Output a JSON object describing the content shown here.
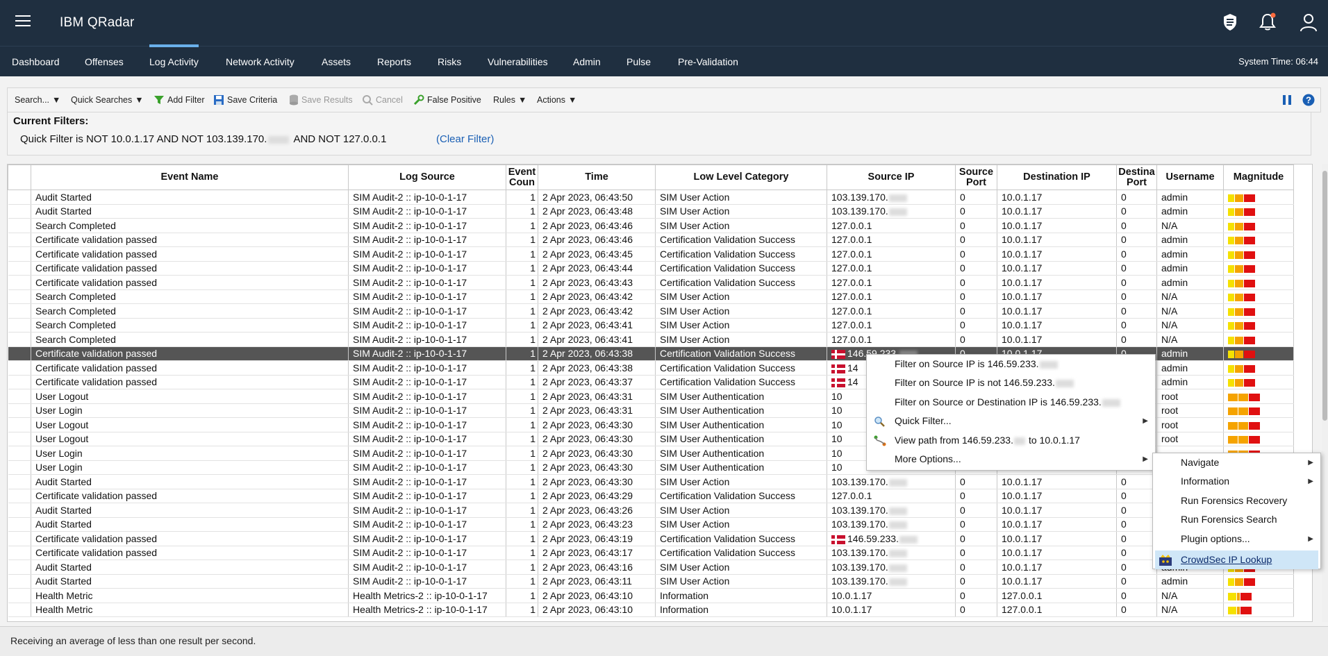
{
  "app": {
    "title": "IBM QRadar",
    "system_time": "System Time: 06:44"
  },
  "nav": {
    "tabs": [
      {
        "label": "Dashboard"
      },
      {
        "label": "Offenses"
      },
      {
        "label": "Log Activity",
        "active": true
      },
      {
        "label": "Network Activity"
      },
      {
        "label": "Assets"
      },
      {
        "label": "Reports"
      },
      {
        "label": "Risks"
      },
      {
        "label": "Vulnerabilities"
      },
      {
        "label": "Admin"
      },
      {
        "label": "Pulse"
      },
      {
        "label": "Pre-Validation"
      }
    ]
  },
  "toolbar": {
    "search": "Search...",
    "quick_searches": "Quick Searches",
    "add_filter": "Add Filter",
    "save_criteria": "Save Criteria",
    "save_results": "Save Results",
    "cancel": "Cancel",
    "false_positive": "False Positive",
    "rules": "Rules",
    "actions": "Actions"
  },
  "filters": {
    "title": "Current Filters:",
    "text_a": "Quick Filter is NOT 10.0.1.17 AND NOT 103.139.170.",
    "text_b": "AND NOT 127.0.0.1",
    "clear": "(Clear Filter)"
  },
  "table": {
    "columns": [
      "",
      "Event Name",
      "Log Source",
      "Event Count",
      "Time",
      "Low Level Category",
      "Source IP",
      "Source Port",
      "Destination IP",
      "Destination Port",
      "Username",
      "Magnitude"
    ],
    "header_display": [
      "",
      "Event Name",
      "Log Source",
      "Event\nCoun",
      "Time",
      "Low Level Category",
      "Source IP",
      "Source\nPort",
      "Destination IP",
      "Destina\nPort",
      "Username",
      "Magnitude"
    ],
    "rows": [
      {
        "name": "Audit Started",
        "source": "SIM Audit-2 :: ip-10-0-1-17",
        "count": "1",
        "time": "2 Apr 2023, 06:43:50",
        "cat": "SIM User Action",
        "sip": "103.139.170.",
        "sport": "0",
        "dip": "10.0.1.17",
        "dport": "0",
        "user": "admin",
        "mag": "low"
      },
      {
        "name": "Audit Started",
        "source": "SIM Audit-2 :: ip-10-0-1-17",
        "count": "1",
        "time": "2 Apr 2023, 06:43:48",
        "cat": "SIM User Action",
        "sip": "103.139.170.",
        "sport": "0",
        "dip": "10.0.1.17",
        "dport": "0",
        "user": "admin",
        "mag": "low"
      },
      {
        "name": "Search Completed",
        "source": "SIM Audit-2 :: ip-10-0-1-17",
        "count": "1",
        "time": "2 Apr 2023, 06:43:46",
        "cat": "SIM User Action",
        "sip": "127.0.0.1",
        "sport": "0",
        "dip": "10.0.1.17",
        "dport": "0",
        "user": "N/A",
        "mag": "low"
      },
      {
        "name": "Certificate validation passed",
        "source": "SIM Audit-2 :: ip-10-0-1-17",
        "count": "1",
        "time": "2 Apr 2023, 06:43:46",
        "cat": "Certification Validation Success",
        "sip": "127.0.0.1",
        "sport": "0",
        "dip": "10.0.1.17",
        "dport": "0",
        "user": "admin",
        "mag": "low"
      },
      {
        "name": "Certificate validation passed",
        "source": "SIM Audit-2 :: ip-10-0-1-17",
        "count": "1",
        "time": "2 Apr 2023, 06:43:45",
        "cat": "Certification Validation Success",
        "sip": "127.0.0.1",
        "sport": "0",
        "dip": "10.0.1.17",
        "dport": "0",
        "user": "admin",
        "mag": "low"
      },
      {
        "name": "Certificate validation passed",
        "source": "SIM Audit-2 :: ip-10-0-1-17",
        "count": "1",
        "time": "2 Apr 2023, 06:43:44",
        "cat": "Certification Validation Success",
        "sip": "127.0.0.1",
        "sport": "0",
        "dip": "10.0.1.17",
        "dport": "0",
        "user": "admin",
        "mag": "low"
      },
      {
        "name": "Certificate validation passed",
        "source": "SIM Audit-2 :: ip-10-0-1-17",
        "count": "1",
        "time": "2 Apr 2023, 06:43:43",
        "cat": "Certification Validation Success",
        "sip": "127.0.0.1",
        "sport": "0",
        "dip": "10.0.1.17",
        "dport": "0",
        "user": "admin",
        "mag": "low"
      },
      {
        "name": "Search Completed",
        "source": "SIM Audit-2 :: ip-10-0-1-17",
        "count": "1",
        "time": "2 Apr 2023, 06:43:42",
        "cat": "SIM User Action",
        "sip": "127.0.0.1",
        "sport": "0",
        "dip": "10.0.1.17",
        "dport": "0",
        "user": "N/A",
        "mag": "low"
      },
      {
        "name": "Search Completed",
        "source": "SIM Audit-2 :: ip-10-0-1-17",
        "count": "1",
        "time": "2 Apr 2023, 06:43:42",
        "cat": "SIM User Action",
        "sip": "127.0.0.1",
        "sport": "0",
        "dip": "10.0.1.17",
        "dport": "0",
        "user": "N/A",
        "mag": "low"
      },
      {
        "name": "Search Completed",
        "source": "SIM Audit-2 :: ip-10-0-1-17",
        "count": "1",
        "time": "2 Apr 2023, 06:43:41",
        "cat": "SIM User Action",
        "sip": "127.0.0.1",
        "sport": "0",
        "dip": "10.0.1.17",
        "dport": "0",
        "user": "N/A",
        "mag": "low"
      },
      {
        "name": "Search Completed",
        "source": "SIM Audit-2 :: ip-10-0-1-17",
        "count": "1",
        "time": "2 Apr 2023, 06:43:41",
        "cat": "SIM User Action",
        "sip": "127.0.0.1",
        "sport": "0",
        "dip": "10.0.1.17",
        "dport": "0",
        "user": "N/A",
        "mag": "low"
      },
      {
        "name": "Certificate validation passed",
        "source": "SIM Audit-2 :: ip-10-0-1-17",
        "count": "1",
        "time": "2 Apr 2023, 06:43:38",
        "cat": "Certification Validation Success",
        "sip": "146.59.233.",
        "flag": true,
        "sport": "0",
        "dip": "10.0.1.17",
        "dport": "0",
        "user": "admin",
        "mag": "low",
        "selected": true
      },
      {
        "name": "Certificate validation passed",
        "source": "SIM Audit-2 :: ip-10-0-1-17",
        "count": "1",
        "time": "2 Apr 2023, 06:43:38",
        "cat": "Certification Validation Success",
        "sip": "14",
        "flag": true,
        "sport": "",
        "dip": "",
        "dport": "",
        "user": "admin",
        "mag": "low"
      },
      {
        "name": "Certificate validation passed",
        "source": "SIM Audit-2 :: ip-10-0-1-17",
        "count": "1",
        "time": "2 Apr 2023, 06:43:37",
        "cat": "Certification Validation Success",
        "sip": "14",
        "flag": true,
        "sport": "",
        "dip": "",
        "dport": "",
        "user": "admin",
        "mag": "low"
      },
      {
        "name": "User Logout",
        "source": "SIM Audit-2 :: ip-10-0-1-17",
        "count": "1",
        "time": "2 Apr 2023, 06:43:31",
        "cat": "SIM User Authentication",
        "sip": "10",
        "sport": "",
        "dip": "",
        "dport": "",
        "user": "root",
        "mag": "mid"
      },
      {
        "name": "User Login",
        "source": "SIM Audit-2 :: ip-10-0-1-17",
        "count": "1",
        "time": "2 Apr 2023, 06:43:31",
        "cat": "SIM User Authentication",
        "sip": "10",
        "sport": "",
        "dip": "",
        "dport": "",
        "user": "root",
        "mag": "mid"
      },
      {
        "name": "User Logout",
        "source": "SIM Audit-2 :: ip-10-0-1-17",
        "count": "1",
        "time": "2 Apr 2023, 06:43:30",
        "cat": "SIM User Authentication",
        "sip": "10",
        "sport": "",
        "dip": "",
        "dport": "",
        "user": "root",
        "mag": "mid"
      },
      {
        "name": "User Logout",
        "source": "SIM Audit-2 :: ip-10-0-1-17",
        "count": "1",
        "time": "2 Apr 2023, 06:43:30",
        "cat": "SIM User Authentication",
        "sip": "10",
        "sport": "",
        "dip": "",
        "dport": "",
        "user": "root",
        "mag": "mid"
      },
      {
        "name": "User Login",
        "source": "SIM Audit-2 :: ip-10-0-1-17",
        "count": "1",
        "time": "2 Apr 2023, 06:43:30",
        "cat": "SIM User Authentication",
        "sip": "10",
        "sport": "",
        "dip": "",
        "dport": "",
        "user": "",
        "mag": "mid"
      },
      {
        "name": "User Login",
        "source": "SIM Audit-2 :: ip-10-0-1-17",
        "count": "1",
        "time": "2 Apr 2023, 06:43:30",
        "cat": "SIM User Authentication",
        "sip": "10",
        "sport": "",
        "dip": "",
        "dport": "",
        "user": "",
        "mag": "mid"
      },
      {
        "name": "Audit Started",
        "source": "SIM Audit-2 :: ip-10-0-1-17",
        "count": "1",
        "time": "2 Apr 2023, 06:43:30",
        "cat": "SIM User Action",
        "sip": "103.139.170.",
        "sport": "0",
        "dip": "10.0.1.17",
        "dport": "0",
        "user": "",
        "mag": "low"
      },
      {
        "name": "Certificate validation passed",
        "source": "SIM Audit-2 :: ip-10-0-1-17",
        "count": "1",
        "time": "2 Apr 2023, 06:43:29",
        "cat": "Certification Validation Success",
        "sip": "127.0.0.1",
        "sport": "0",
        "dip": "10.0.1.17",
        "dport": "0",
        "user": "",
        "mag": "low"
      },
      {
        "name": "Audit Started",
        "source": "SIM Audit-2 :: ip-10-0-1-17",
        "count": "1",
        "time": "2 Apr 2023, 06:43:26",
        "cat": "SIM User Action",
        "sip": "103.139.170.",
        "sport": "0",
        "dip": "10.0.1.17",
        "dport": "0",
        "user": "",
        "mag": "low"
      },
      {
        "name": "Audit Started",
        "source": "SIM Audit-2 :: ip-10-0-1-17",
        "count": "1",
        "time": "2 Apr 2023, 06:43:23",
        "cat": "SIM User Action",
        "sip": "103.139.170.",
        "sport": "0",
        "dip": "10.0.1.17",
        "dport": "0",
        "user": "",
        "mag": "low"
      },
      {
        "name": "Certificate validation passed",
        "source": "SIM Audit-2 :: ip-10-0-1-17",
        "count": "1",
        "time": "2 Apr 2023, 06:43:19",
        "cat": "Certification Validation Success",
        "sip": "146.59.233.",
        "flag": true,
        "sport": "0",
        "dip": "10.0.1.17",
        "dport": "0",
        "user": "",
        "mag": "low"
      },
      {
        "name": "Certificate validation passed",
        "source": "SIM Audit-2 :: ip-10-0-1-17",
        "count": "1",
        "time": "2 Apr 2023, 06:43:17",
        "cat": "Certification Validation Success",
        "sip": "103.139.170.",
        "sport": "0",
        "dip": "10.0.1.17",
        "dport": "0",
        "user": "",
        "mag": "low"
      },
      {
        "name": "Audit Started",
        "source": "SIM Audit-2 :: ip-10-0-1-17",
        "count": "1",
        "time": "2 Apr 2023, 06:43:16",
        "cat": "SIM User Action",
        "sip": "103.139.170.",
        "sport": "0",
        "dip": "10.0.1.17",
        "dport": "0",
        "user": "admin",
        "mag": "low"
      },
      {
        "name": "Audit Started",
        "source": "SIM Audit-2 :: ip-10-0-1-17",
        "count": "1",
        "time": "2 Apr 2023, 06:43:11",
        "cat": "SIM User Action",
        "sip": "103.139.170.",
        "sport": "0",
        "dip": "10.0.1.17",
        "dport": "0",
        "user": "admin",
        "mag": "low"
      },
      {
        "name": "Health Metric",
        "source": "Health Metrics-2 :: ip-10-0-1-17",
        "count": "1",
        "time": "2 Apr 2023, 06:43:10",
        "cat": "Information",
        "sip": "10.0.1.17",
        "sport": "0",
        "dip": "127.0.0.1",
        "dport": "0",
        "user": "N/A",
        "mag": "hm"
      },
      {
        "name": "Health Metric",
        "source": "Health Metrics-2 :: ip-10-0-1-17",
        "count": "1",
        "time": "2 Apr 2023, 06:43:10",
        "cat": "Information",
        "sip": "10.0.1.17",
        "sport": "0",
        "dip": "127.0.0.1",
        "dport": "0",
        "user": "N/A",
        "mag": "hm"
      }
    ]
  },
  "context_menu": {
    "items": [
      {
        "label": "Filter on Source IP is 146.59.233.",
        "blur": true
      },
      {
        "label": "Filter on Source IP is not 146.59.233.",
        "blur": true
      },
      {
        "label": "Filter on Source or Destination IP is 146.59.233.",
        "blur": true
      },
      {
        "label": "Quick Filter...",
        "icon": "search-icon",
        "submenu": true
      },
      {
        "label_a": "View path from 146.59.233.",
        "label_b": "to 10.0.1.17",
        "icon": "path-icon"
      },
      {
        "label": "More Options...",
        "submenu": true
      }
    ]
  },
  "submenu": {
    "items": [
      {
        "label": "Navigate",
        "submenu": true
      },
      {
        "label": "Information",
        "submenu": true
      },
      {
        "label": "Run Forensics Recovery"
      },
      {
        "label": "Run Forensics Search"
      },
      {
        "label": "Plugin options...",
        "submenu": true
      },
      {
        "label": "CrowdSec IP Lookup",
        "highlighted": true,
        "icon": "crowdsec-icon"
      }
    ]
  },
  "footer": {
    "status": "Receiving an average of less than one result per second."
  },
  "colors": {
    "topbar": "#1f2f40",
    "selected_row": "#555555",
    "link": "#1a5fb4",
    "mag_yellow": "#f5e100",
    "mag_orange": "#f5a300",
    "mag_red": "#e01010"
  }
}
